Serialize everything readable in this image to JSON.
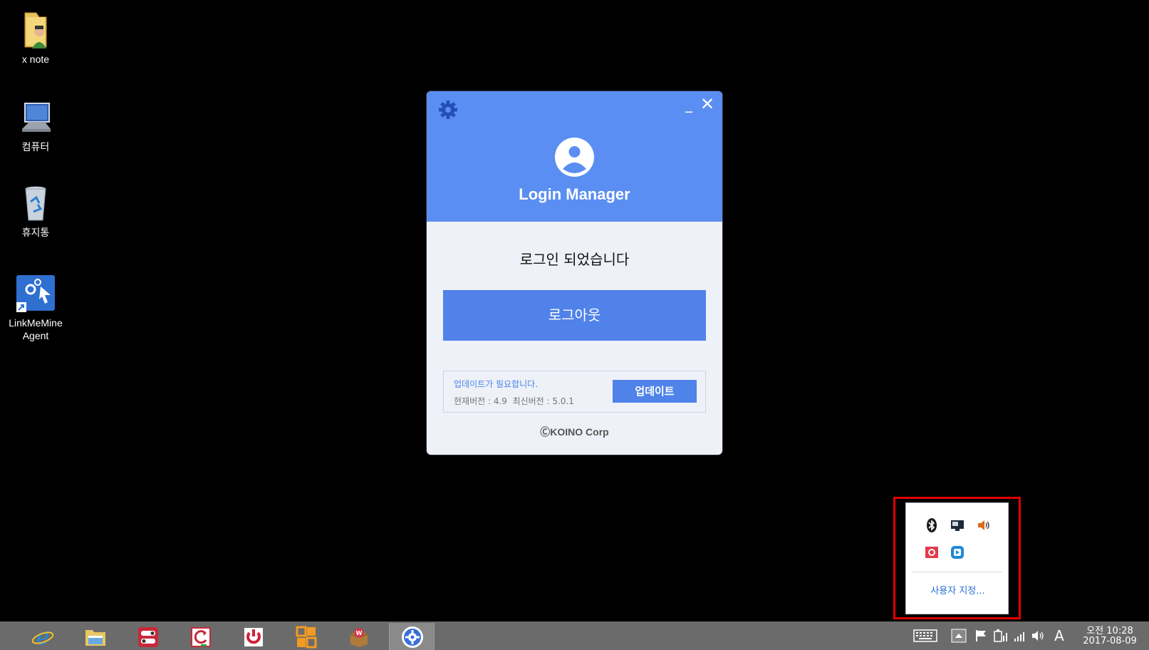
{
  "desktop": {
    "icons": [
      {
        "label": "x note"
      },
      {
        "label": "컴퓨터"
      },
      {
        "label": "휴지통"
      },
      {
        "label": "LinkMeMine Agent"
      }
    ]
  },
  "login_window": {
    "title": "Login Manager",
    "minimize_glyph": "_",
    "close_glyph": "✕",
    "status_message": "로그인 되었습니다",
    "logout_label": "로그아웃",
    "update": {
      "notice": "업데이트가 필요합니다.",
      "current_version": "현재버전 : 4.9",
      "latest_version": "최신버전 : 5.0.1",
      "button_label": "업데이트"
    },
    "copyright": "ⒸKOINO Corp"
  },
  "tray_popup": {
    "icons": [
      "bluetooth-icon",
      "display-icon",
      "speaker-icon",
      "red-app-icon",
      "blue-app-icon"
    ],
    "customize_label": "사용자 지정..."
  },
  "taskbar": {
    "apps": [
      "internet-explorer-icon",
      "file-explorer-icon",
      "remote-control-icon",
      "sync-icon",
      "power-app-icon",
      "office-icon",
      "package-icon",
      "login-manager-icon"
    ],
    "ime_label": "A",
    "clock_time": "오전 10:28",
    "clock_date": "2017-08-09"
  },
  "colors": {
    "header_blue": "#5b8ef2",
    "button_blue": "#5082ea",
    "link_blue": "#4a86e8",
    "highlight_red": "#e00000",
    "taskbar_gray": "#6b6b6b"
  }
}
